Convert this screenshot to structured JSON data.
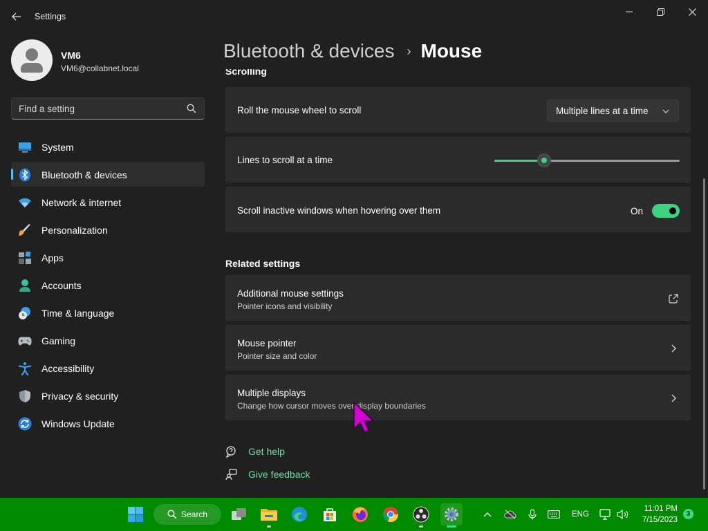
{
  "app": {
    "title": "Settings"
  },
  "profile": {
    "name": "VM6",
    "email": "VM6@collabnet.local"
  },
  "search": {
    "placeholder": "Find a setting"
  },
  "nav": {
    "items": [
      {
        "label": "System",
        "icon": "system-icon"
      },
      {
        "label": "Bluetooth & devices",
        "icon": "bluetooth-icon",
        "selected": true
      },
      {
        "label": "Network & internet",
        "icon": "wifi-icon"
      },
      {
        "label": "Personalization",
        "icon": "brush-icon"
      },
      {
        "label": "Apps",
        "icon": "apps-icon"
      },
      {
        "label": "Accounts",
        "icon": "accounts-icon"
      },
      {
        "label": "Time & language",
        "icon": "clock-globe-icon"
      },
      {
        "label": "Gaming",
        "icon": "gamepad-icon"
      },
      {
        "label": "Accessibility",
        "icon": "accessibility-icon"
      },
      {
        "label": "Privacy & security",
        "icon": "shield-icon"
      },
      {
        "label": "Windows Update",
        "icon": "update-icon"
      }
    ]
  },
  "header": {
    "parent": "Bluetooth & devices",
    "separator": "›",
    "current": "Mouse"
  },
  "scrolling": {
    "section_title": "Scrolling",
    "wheel": {
      "label": "Roll the mouse wheel to scroll",
      "value": "Multiple lines at a time"
    },
    "lines": {
      "label": "Lines to scroll at a time",
      "fraction": 0.27
    },
    "inactive": {
      "label": "Scroll inactive windows when hovering over them",
      "state": "On"
    }
  },
  "related": {
    "title": "Related settings",
    "items": [
      {
        "title": "Additional mouse settings",
        "subtitle": "Pointer icons and visibility",
        "action_icon": "open-external-icon"
      },
      {
        "title": "Mouse pointer",
        "subtitle": "Pointer size and color",
        "action_icon": "chevron-right-icon"
      },
      {
        "title": "Multiple displays",
        "subtitle": "Change how cursor moves over display boundaries",
        "action_icon": "chevron-right-icon"
      }
    ]
  },
  "help": {
    "get_help": "Get help",
    "give_feedback": "Give feedback"
  },
  "taskbar": {
    "search_label": "Search",
    "tray": {
      "language": "ENG"
    },
    "clock": {
      "time": "11:01 PM",
      "date": "7/15/2023"
    },
    "notification_count": "3"
  },
  "colors": {
    "accent": "#3dd27f",
    "link": "#6fdca0",
    "taskbar": "#008a00",
    "selection_indicator": "#4cc2ff",
    "cursor": "#d600d6"
  }
}
